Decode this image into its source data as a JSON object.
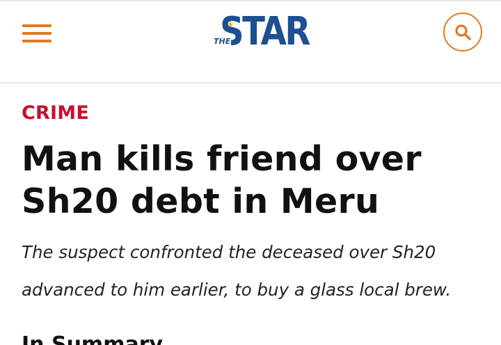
{
  "colors": {
    "accent_orange": "#e07a1f",
    "category_red": "#c8102e",
    "logo_blue": "#1d4f91",
    "logo_gold": "#f4b400"
  },
  "header": {
    "menu_icon": "hamburger-menu-icon",
    "logo": {
      "main": "STAR",
      "sub": "THE"
    },
    "search_icon": "search-icon"
  },
  "article": {
    "category": "CRIME",
    "headline": "Man kills friend over Sh20 debt in Meru",
    "summary": "The suspect confronted the deceased over Sh20 advanced to him earlier, to buy a glass local brew.",
    "section_heading": "In Summary"
  }
}
